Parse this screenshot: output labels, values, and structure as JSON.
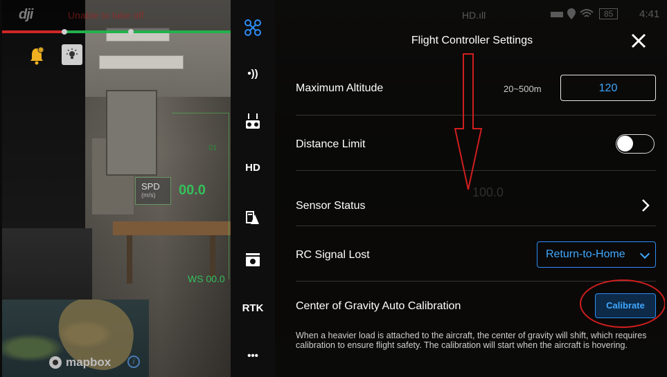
{
  "status_bar": {
    "logo": "dji",
    "warning": "Unable to take off",
    "battery": "85",
    "time": "4:41",
    "signal_labels": [
      "HD.ıll"
    ]
  },
  "hud": {
    "spd_label": "SPD",
    "spd_unit": "(m/s)",
    "spd_value": "00.0",
    "ws": "WS 00.0",
    "mark": "01"
  },
  "map": {
    "brand": "mapbox",
    "info": "i"
  },
  "sidebar": {
    "items": [
      {
        "id": "aircraft",
        "label": ""
      },
      {
        "id": "signal",
        "label": "•))"
      },
      {
        "id": "remote",
        "label": ""
      },
      {
        "id": "hd",
        "label": "HD"
      },
      {
        "id": "gimbal",
        "label": ""
      },
      {
        "id": "camera",
        "label": ""
      },
      {
        "id": "rtk",
        "label": "RTK"
      },
      {
        "id": "more",
        "label": "•••"
      }
    ]
  },
  "panel": {
    "title": "Flight Controller Settings",
    "rows": {
      "max_altitude": {
        "label": "Maximum Altitude",
        "range": "20~500m",
        "value": "120"
      },
      "distance_limit": {
        "label": "Distance Limit",
        "enabled": false
      },
      "sensor_status": {
        "label": "Sensor Status"
      },
      "rc_signal_lost": {
        "label": "RC Signal Lost",
        "value": "Return-to-Home"
      },
      "cog_calibration": {
        "label": "Center of Gravity Auto Calibration",
        "button": "Calibrate",
        "description": "When a heavier load is attached to the aircraft, the center of gravity will shift, which requires calibration to ensure flight safety. The calibration will start when the aircraft is hovering."
      }
    }
  },
  "colors": {
    "accent": "#3fa8ff",
    "annotation": "#d11e1e",
    "hud_green": "#33c15a"
  }
}
